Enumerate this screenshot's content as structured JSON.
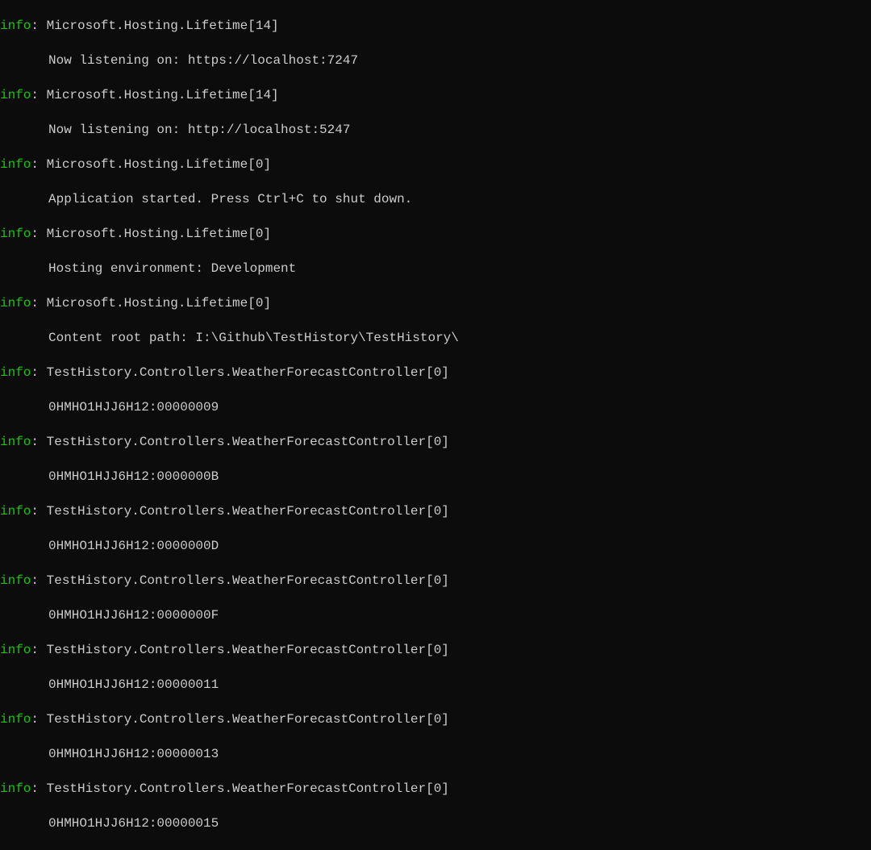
{
  "log": {
    "entries": [
      {
        "level": "info",
        "source": "Microsoft.Hosting.Lifetime[14]",
        "message": "Now listening on: https://localhost:7247"
      },
      {
        "level": "info",
        "source": "Microsoft.Hosting.Lifetime[14]",
        "message": "Now listening on: http://localhost:5247"
      },
      {
        "level": "info",
        "source": "Microsoft.Hosting.Lifetime[0]",
        "message": "Application started. Press Ctrl+C to shut down."
      },
      {
        "level": "info",
        "source": "Microsoft.Hosting.Lifetime[0]",
        "message": "Hosting environment: Development"
      },
      {
        "level": "info",
        "source": "Microsoft.Hosting.Lifetime[0]",
        "message": "Content root path: I:\\Github\\TestHistory\\TestHistory\\"
      },
      {
        "level": "info",
        "source": "TestHistory.Controllers.WeatherForecastController[0]",
        "message": "0HMHO1HJJ6H12:00000009"
      },
      {
        "level": "info",
        "source": "TestHistory.Controllers.WeatherForecastController[0]",
        "message": "0HMHO1HJJ6H12:0000000B"
      },
      {
        "level": "info",
        "source": "TestHistory.Controllers.WeatherForecastController[0]",
        "message": "0HMHO1HJJ6H12:0000000D"
      },
      {
        "level": "info",
        "source": "TestHistory.Controllers.WeatherForecastController[0]",
        "message": "0HMHO1HJJ6H12:0000000F"
      },
      {
        "level": "info",
        "source": "TestHistory.Controllers.WeatherForecastController[0]",
        "message": "0HMHO1HJJ6H12:00000011"
      },
      {
        "level": "info",
        "source": "TestHistory.Controllers.WeatherForecastController[0]",
        "message": "0HMHO1HJJ6H12:00000013"
      },
      {
        "level": "info",
        "source": "TestHistory.Controllers.WeatherForecastController[0]",
        "message": "0HMHO1HJJ6H12:00000015"
      }
    ],
    "separator": ": "
  }
}
